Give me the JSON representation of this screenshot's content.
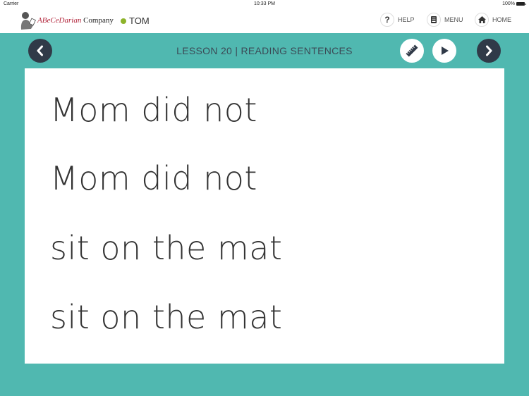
{
  "status_bar": {
    "carrier": "Carrier",
    "time": "10:33 PM",
    "battery": "100%"
  },
  "header": {
    "logo": {
      "accent_part": "ABeCeDarian",
      "rest": " Company",
      "icon": "reader-illustration-icon"
    },
    "user": {
      "name": "TOM",
      "status_color": "#8db32a"
    },
    "nav": [
      {
        "label": "HELP",
        "icon": "question-icon"
      },
      {
        "label": "MENU",
        "icon": "menu-icon"
      },
      {
        "label": "HOME",
        "icon": "home-icon"
      }
    ]
  },
  "lesson": {
    "title": "LESSON 20 | READING SENTENCES",
    "prev_icon": "chevron-left-icon",
    "next_icon": "chevron-right-icon",
    "ruler_icon": "ruler-icon",
    "play_icon": "play-icon"
  },
  "content": {
    "sentences": [
      "Mom did not",
      "Mom did not",
      "sit on the mat",
      "sit on the mat"
    ]
  },
  "colors": {
    "background": "#50b8b0",
    "dark_button": "#303a48",
    "accent": "#b2243a"
  }
}
